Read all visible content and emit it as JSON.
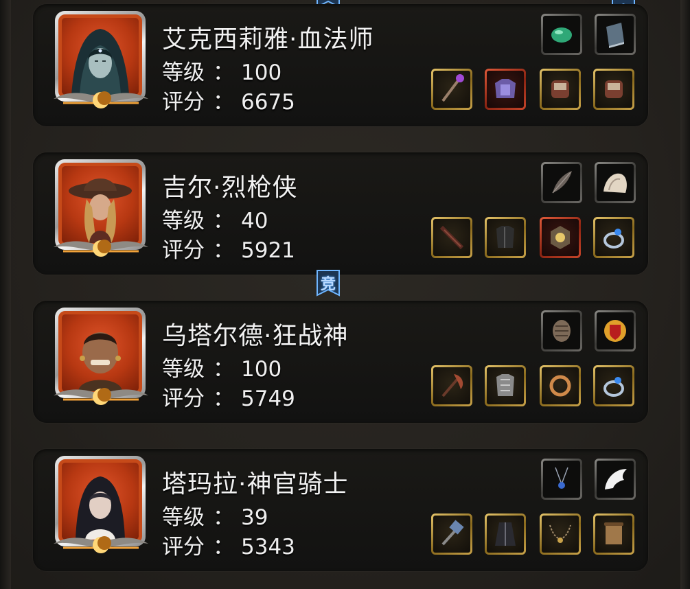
{
  "labels": {
    "level": "等级",
    "score": "评分",
    "separator": "："
  },
  "badge": {
    "char": "竞"
  },
  "heroes": [
    {
      "name": "艾克西莉雅·血法师",
      "level": "100",
      "score": "6675",
      "portrait": "hooded-mage-portrait",
      "top_items": [
        "green-gem-icon",
        "book-icon"
      ],
      "bottom_items": [
        "staff-icon",
        "armor-icon",
        "bracer-icon",
        "bracer-icon"
      ]
    },
    {
      "name": "吉尔·烈枪侠",
      "level": "40",
      "score": "5921",
      "portrait": "gunslinger-portrait",
      "top_items": [
        "feather-icon",
        "fur-icon"
      ],
      "bottom_items": [
        "rifle-icon",
        "vest-icon",
        "medallion-icon",
        "blue-ring-icon"
      ]
    },
    {
      "name": "乌塔尔德·狂战神",
      "level": "100",
      "score": "5749",
      "portrait": "berserker-portrait",
      "top_items": [
        "shell-icon",
        "emblem-icon"
      ],
      "bottom_items": [
        "axe-icon",
        "breastplate-icon",
        "gold-ring-icon",
        "blue-ring-icon"
      ]
    },
    {
      "name": "塔玛拉·神官骑士",
      "level": "39",
      "score": "5343",
      "portrait": "nun-portrait",
      "top_items": [
        "necklace-icon",
        "wing-icon"
      ],
      "bottom_items": [
        "hammer-icon",
        "robe-icon",
        "chain-necklace-icon",
        "scroll-icon"
      ]
    }
  ]
}
